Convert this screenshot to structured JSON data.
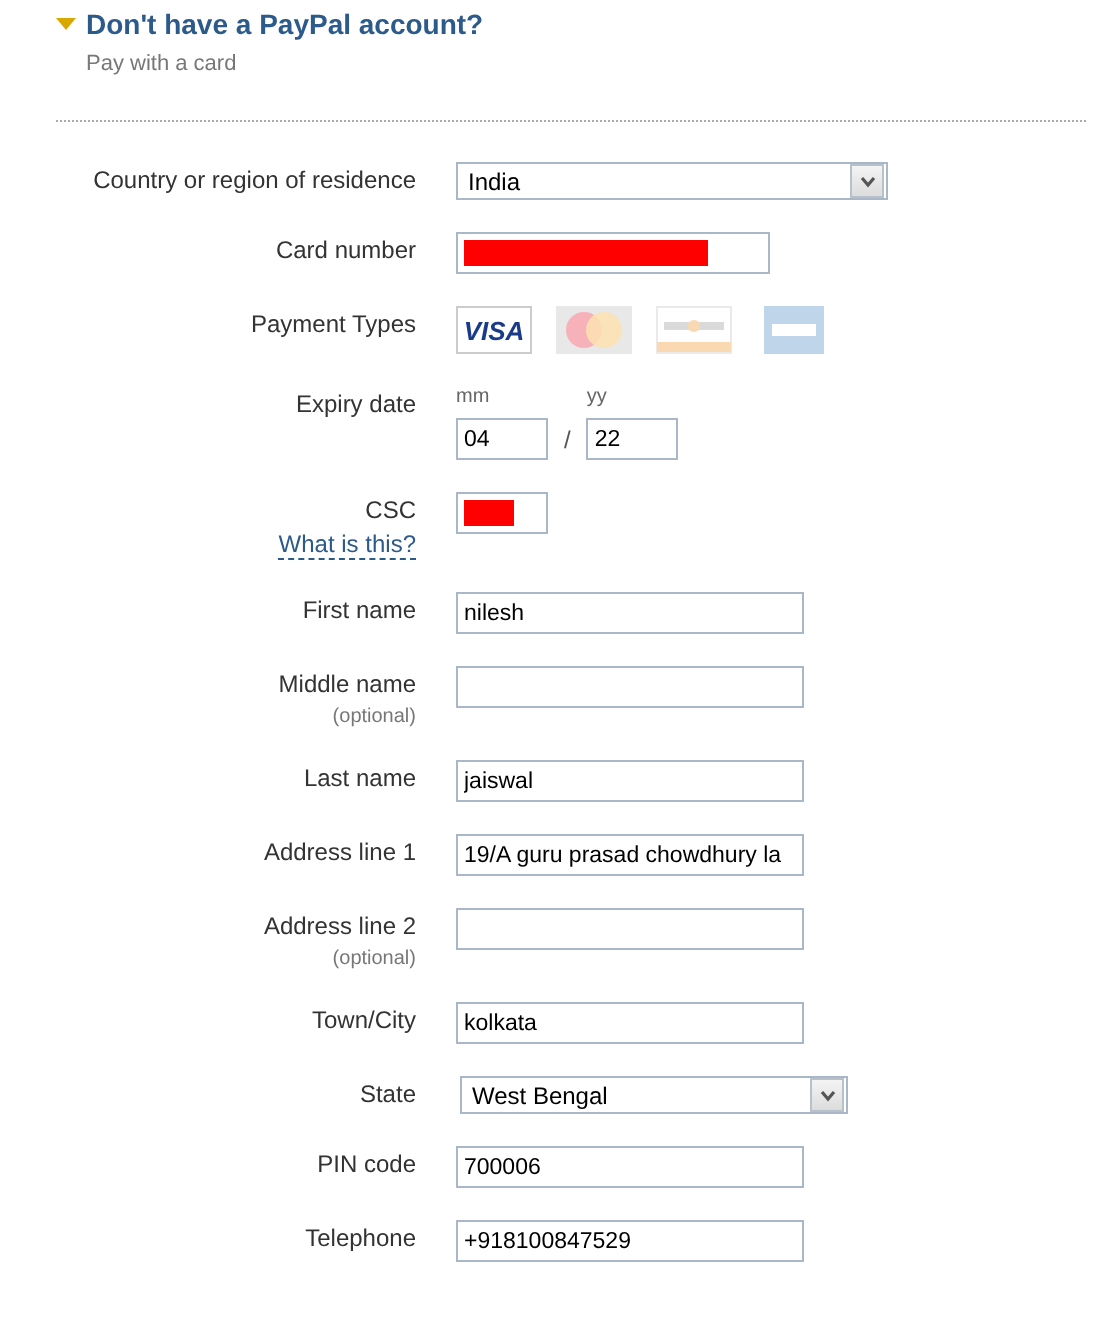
{
  "section": {
    "title": "Don't have a PayPal account?",
    "expanded": true,
    "subtitle": "Pay with a card"
  },
  "rows": [
    {
      "kind": "select",
      "label": "Country or region of residence",
      "value": "India",
      "wide": true
    },
    {
      "kind": "text",
      "label": "Card number",
      "value_redacted": true
    },
    {
      "kind": "cards",
      "label": "Payment Types",
      "cards": [
        {
          "kind": "visa",
          "text": "VISA",
          "selected": true
        },
        {
          "kind": "mastercard",
          "selected": false
        },
        {
          "kind": "discover",
          "selected": false
        },
        {
          "kind": "amex",
          "selected": false
        }
      ]
    },
    {
      "kind": "expiry",
      "label": "Expiry date",
      "month_label": "mm",
      "month": "04",
      "separator": "/",
      "year_label": "yy",
      "year": "22"
    },
    {
      "kind": "csc",
      "label": "CSC",
      "link": "What is this?",
      "value_redacted": true
    },
    {
      "kind": "text",
      "label": "First name",
      "value": "nilesh"
    },
    {
      "kind": "text",
      "label": "Middle name",
      "note": "(optional)",
      "value": ""
    },
    {
      "kind": "text",
      "label": "Last name",
      "value": "jaiswal"
    },
    {
      "kind": "text",
      "label": "Address line 1",
      "value": "19/A guru prasad chowdhury la"
    },
    {
      "kind": "text",
      "label": "Address line 2",
      "note": "(optional)",
      "value": ""
    },
    {
      "kind": "text",
      "label": "Town/City",
      "value": "kolkata"
    },
    {
      "kind": "select",
      "label": "State",
      "value": "West Bengal",
      "wide": false
    },
    {
      "kind": "text",
      "label": "PIN code",
      "value": "700006"
    },
    {
      "kind": "text",
      "label": "Telephone",
      "value": "+918100847529"
    }
  ]
}
